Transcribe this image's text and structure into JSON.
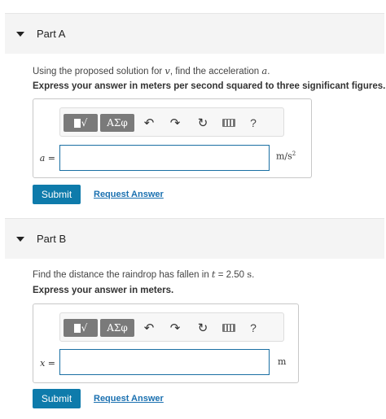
{
  "parts": [
    {
      "title": "Part A",
      "prompt_text": "Using the proposed solution for ",
      "prompt_var": "v",
      "prompt_mid": ", find the acceleration ",
      "prompt_var2": "a",
      "prompt_end": ".",
      "instruction": "Express your answer in meters per second squared to three significant figures.",
      "variable": "a",
      "equals": " =",
      "input_value": "",
      "unit": "m/s",
      "unit_sup": "2",
      "submit_label": "Submit",
      "request_label": "Request Answer"
    },
    {
      "title": "Part B",
      "prompt_text": "Find the distance the raindrop has fallen in ",
      "prompt_var": "t",
      "prompt_mid": " = 2.50 ",
      "prompt_var2": "s",
      "prompt_end": ".",
      "instruction": "Express your answer in meters.",
      "variable": "x",
      "equals": " =",
      "input_value": "",
      "unit": "m",
      "unit_sup": "",
      "submit_label": "Submit",
      "request_label": "Request Answer"
    }
  ],
  "toolbar": {
    "templates_label": "√",
    "symbols_label": "ΑΣφ",
    "undo_icon": "undo-icon",
    "redo_icon": "redo-icon",
    "reset_icon": "reset-icon",
    "keyboard_icon": "keyboard-icon",
    "help_label": "?"
  },
  "colors": {
    "submit_bg": "#0e7bab",
    "link": "#1a70b0",
    "input_border": "#1a6fa3",
    "header_bg": "#f4f4f4"
  }
}
